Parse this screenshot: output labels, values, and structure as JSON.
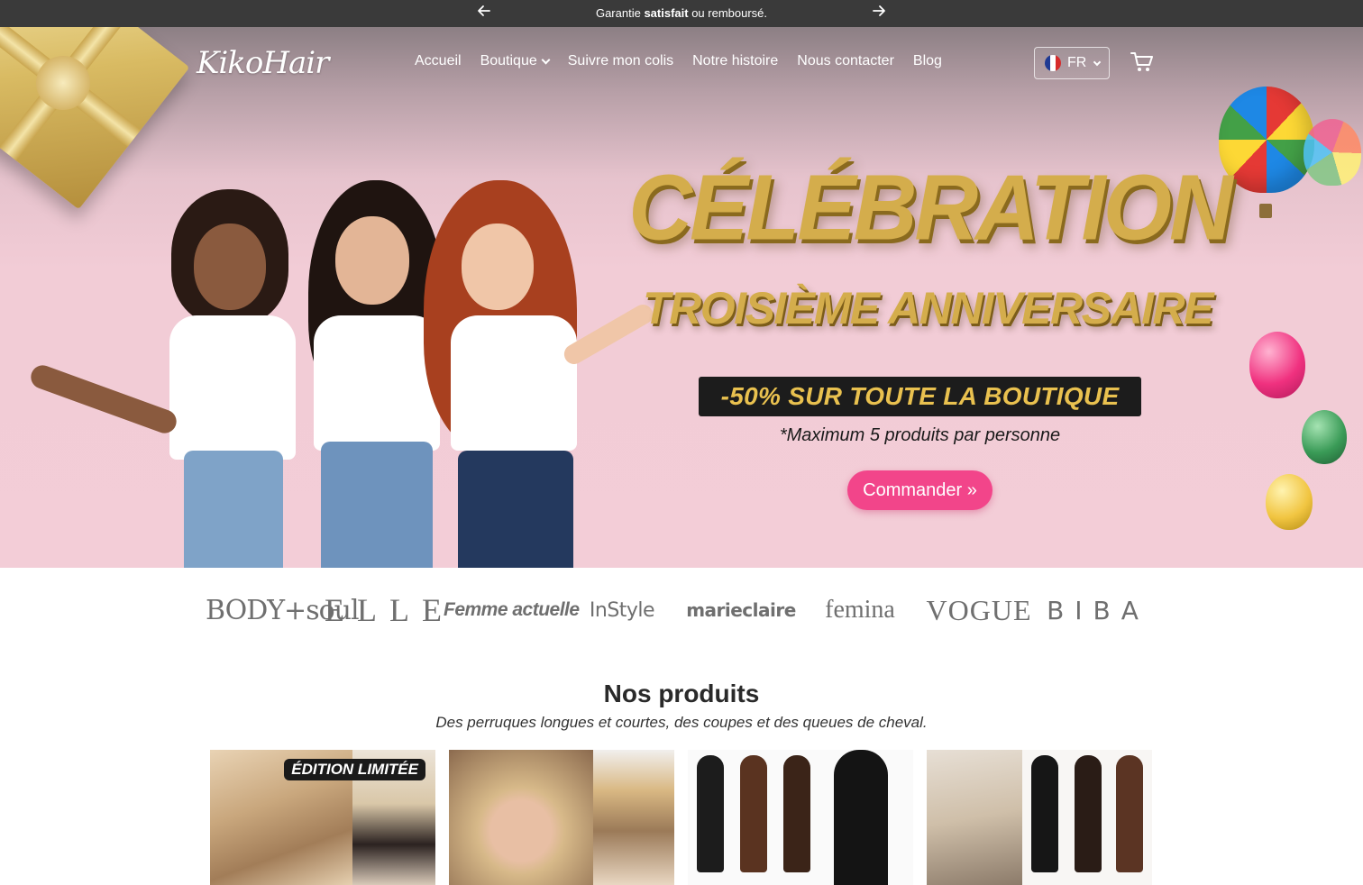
{
  "announcement": {
    "prefix": "Garantie ",
    "emphasis": "satisfait",
    "suffix": " ou remboursé."
  },
  "brand": {
    "logo_text": "KikoHair"
  },
  "nav": {
    "items": [
      {
        "label": "Accueil"
      },
      {
        "label": "Boutique"
      },
      {
        "label": "Suivre mon colis"
      },
      {
        "label": "Notre histoire"
      },
      {
        "label": "Nous contacter"
      },
      {
        "label": "Blog"
      }
    ],
    "language": "FR"
  },
  "hero": {
    "headline": "CÉLÉBRATION",
    "subheadline": "TROISIÈME ANNIVERSAIRE",
    "promo": "-50% SUR TOUTE LA BOUTIQUE",
    "note": "*Maximum 5 produits par personne",
    "cta": "Commander »"
  },
  "press": {
    "logos": [
      {
        "name": "BODY+soul"
      },
      {
        "name": "ELLE"
      },
      {
        "name": "Femme actuelle"
      },
      {
        "name": "InStyle"
      },
      {
        "name": "marieclaire"
      },
      {
        "name": "femina"
      },
      {
        "name": "VOGUE"
      },
      {
        "name": "BIBA"
      }
    ]
  },
  "products": {
    "title": "Nos produits",
    "subtitle": "Des perruques longues et courtes, des coupes et des queues de cheval.",
    "badge": "ÉDITION LIMITÉE"
  },
  "colors": {
    "accent_pink": "#f2458a",
    "gold": "#d4ad4c",
    "announcement_bg": "#3a3a3a",
    "hero_pink": "#f3cdd7"
  }
}
